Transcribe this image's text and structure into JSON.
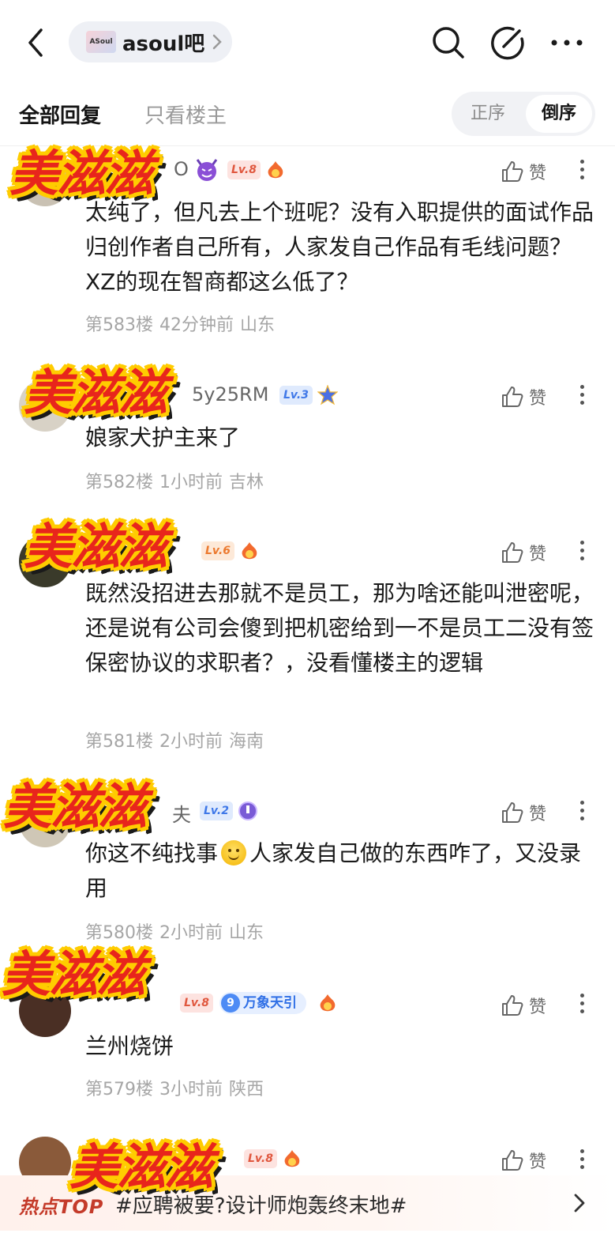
{
  "header": {
    "forum_logo_text": "ASoul",
    "forum_name": "asoul吧"
  },
  "tabs": {
    "all_replies": "全部回复",
    "op_only": "只看楼主",
    "sort_asc": "正序",
    "sort_desc": "倒序"
  },
  "sticker_text": "美滋滋",
  "like_label": "赞",
  "posts": [
    {
      "username": "O",
      "level": "Lv.8",
      "content": "太纯了，但凡去上个班呢？没有入职提供的面试作品归创作者自己所有，人家发自己作品有毛线问题？XZ的现在智商都这么低了？",
      "floor": "第583楼",
      "time": "42分钟前",
      "location": "山东"
    },
    {
      "username": "5y25RM",
      "level": "Lv.3",
      "content": "娘家犬护主来了",
      "floor": "第582楼",
      "time": "1小时前",
      "location": "吉林"
    },
    {
      "username": "",
      "level": "Lv.6",
      "content": "既然没招进去那就不是员工，那为啥还能叫泄密呢，还是说有公司会傻到把机密给到一不是员工二没有签保密协议的求职者？，没看懂楼主的逻辑",
      "floor": "第581楼",
      "time": "2小时前",
      "location": "海南"
    },
    {
      "username": "夫",
      "level": "Lv.2",
      "content_a": "你这不纯找事",
      "content_b": "人家发自己做的东西咋了，又没录用",
      "floor": "第580楼",
      "time": "2小时前",
      "location": "山东"
    },
    {
      "username": "",
      "level": "Lv.8",
      "badge_num": "9",
      "badge_text": "万象天引",
      "content": "兰州烧饼",
      "floor": "第579楼",
      "time": "3小时前",
      "location": "陕西"
    },
    {
      "username": "",
      "level": "Lv.8"
    }
  ],
  "hotbar": {
    "tag": "热点TOP",
    "text": "#应聘被要?设计师炮轰终末地#"
  }
}
